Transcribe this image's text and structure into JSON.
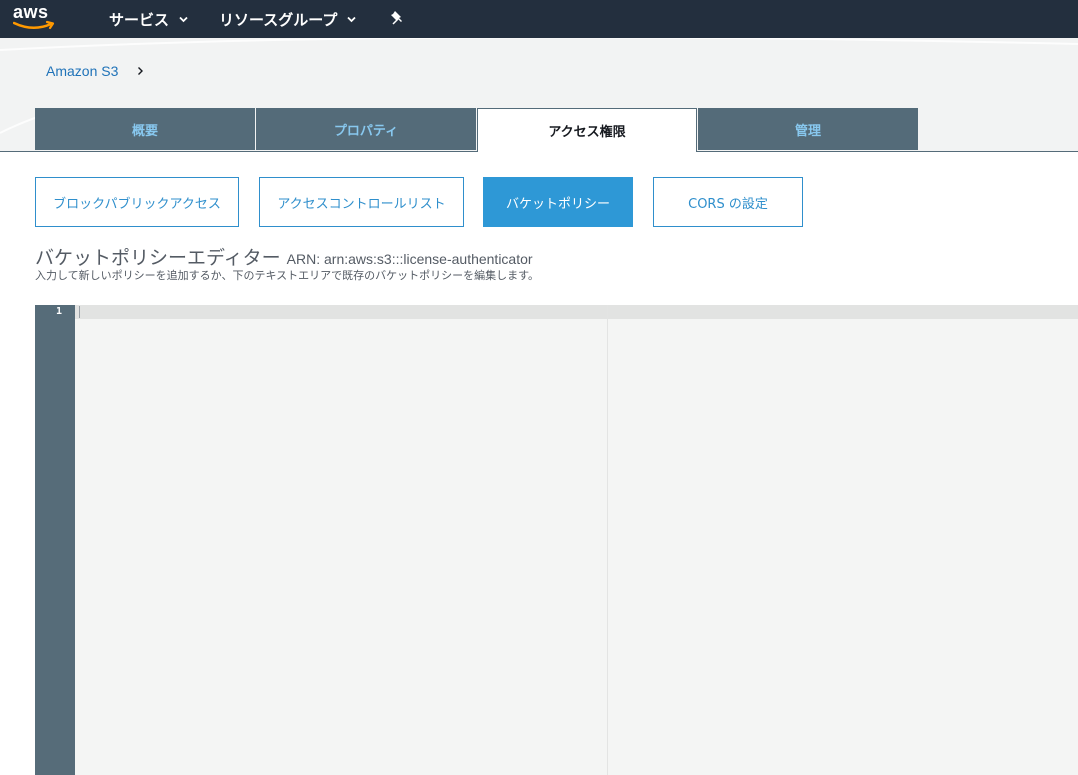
{
  "topnav": {
    "logo_text": "aws",
    "services_label": "サービス",
    "resource_groups_label": "リソースグループ",
    "pin_icon": "pin-icon",
    "chevron_icon": "chevron-down-icon"
  },
  "breadcrumb": {
    "root_label": "Amazon S3",
    "separator_icon": "chevron-right-icon"
  },
  "tabs": [
    {
      "label": "概要"
    },
    {
      "label": "プロパティ"
    },
    {
      "label": "アクセス権限",
      "active": true
    },
    {
      "label": "管理"
    }
  ],
  "subtabs": [
    {
      "label": "ブロックパブリックアクセス"
    },
    {
      "label": "アクセスコントロールリスト"
    },
    {
      "label": "バケットポリシー",
      "active": true
    },
    {
      "label": "CORS の設定"
    }
  ],
  "editor": {
    "title": "バケットポリシーエディター",
    "arn": "ARN: arn:aws:s3:::license-authenticator",
    "description": "入力して新しいポリシーを追加するか、下のテキストエリアで既存のバケットポリシーを編集します。",
    "line_numbers": [
      "1"
    ],
    "content": ""
  },
  "colors": {
    "nav_bg": "#232f3e",
    "tab_bg": "#546b79",
    "tab_text": "#88c8ef",
    "accent_blue": "#2e98d6",
    "link_blue": "#1f72b8",
    "logo_smile": "#ff9900"
  }
}
